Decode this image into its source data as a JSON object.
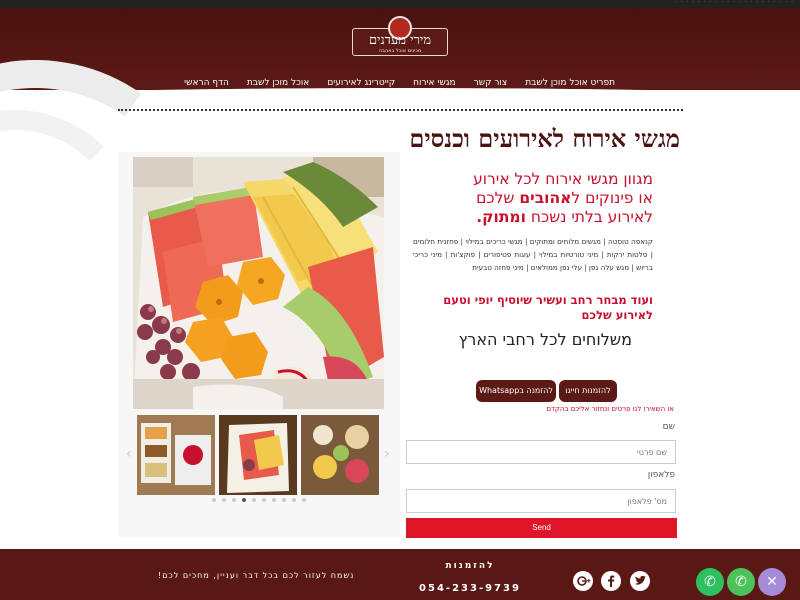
{
  "topbar": {
    "text": "· · · · · · · · · · · · · · · · · · · · ·"
  },
  "brand": {
    "name": "מירי מעדנים",
    "tagline": "מכינים אוכל באהבה"
  },
  "nav": {
    "items": [
      {
        "label": "הדף הראשי",
        "active": false
      },
      {
        "label": "אוכל מוכן לשבת",
        "active": false
      },
      {
        "label": "קייטרינג לאירועים",
        "active": false
      },
      {
        "label": "מגשי אירוח",
        "active": true
      },
      {
        "label": "צור קשר",
        "active": false
      },
      {
        "label": "תפריט אוכל מוכן לשבת",
        "active": false
      }
    ]
  },
  "page": {
    "title": "מגשי אירוח לאירועים וכנסים"
  },
  "gallery": {
    "prev": "‹",
    "next": "›",
    "dot_count": 10,
    "active_dot": 3
  },
  "promo": {
    "line1": "מגוון מגשי אירוח לכל אירוע",
    "line2_pre": "או פינוקים ל",
    "line2_bold": "אהובים",
    "line2_post": " שלכם",
    "line3_pre": "לאירוע בלתי נשכח ",
    "line3_bold": "ומתוק.",
    "tags": "קנאפה טוסטה | מגשים מלוחים ומתוקים | מגשי כריכים במילוי | פחזנית חלומים | סלטות ירקות | מיני טורטיות במילוי | עוגות פטיפורים | פוקצ'ות | מיני כריכי בריוש | מגש עלה גפן | עלי גפן ממולאים | מיני פחזה טבעית",
    "more": "ועוד מבחר רחב ועשיר שיוסיף יופי וטעם לאירוע שלכם",
    "shipping": "משלוחים לכל רחבי הארץ",
    "btn_call": "להזמנות חייגו",
    "btn_whatsapp": "להזמנה בWhatsapp",
    "note": "או השאירו לנו פרטים ונחזור אליכם בהקדם"
  },
  "form": {
    "name_label": "שם",
    "name_placeholder": "שם פרטי",
    "phone_label": "פלאפון",
    "phone_placeholder": "מס' פלאפון",
    "submit": "Send"
  },
  "footer": {
    "orders": "להזמנות",
    "phone": "054-233-9739",
    "slogan": "נשמח לעזור לכם בכל דבר ועניין, מחכים לכם!",
    "social": [
      "twitter-icon",
      "facebook-icon",
      "google-plus-icon"
    ]
  },
  "fabs": {
    "close": "✕",
    "whatsapp": "✆",
    "phone": "✆",
    "colors": {
      "close": "#a58bd8",
      "whatsapp": "#4cc35a",
      "phone": "#2fbf5e"
    }
  },
  "colors": {
    "brand": "#5c1a16",
    "accent": "#c8102e",
    "submit": "#e0152a"
  }
}
